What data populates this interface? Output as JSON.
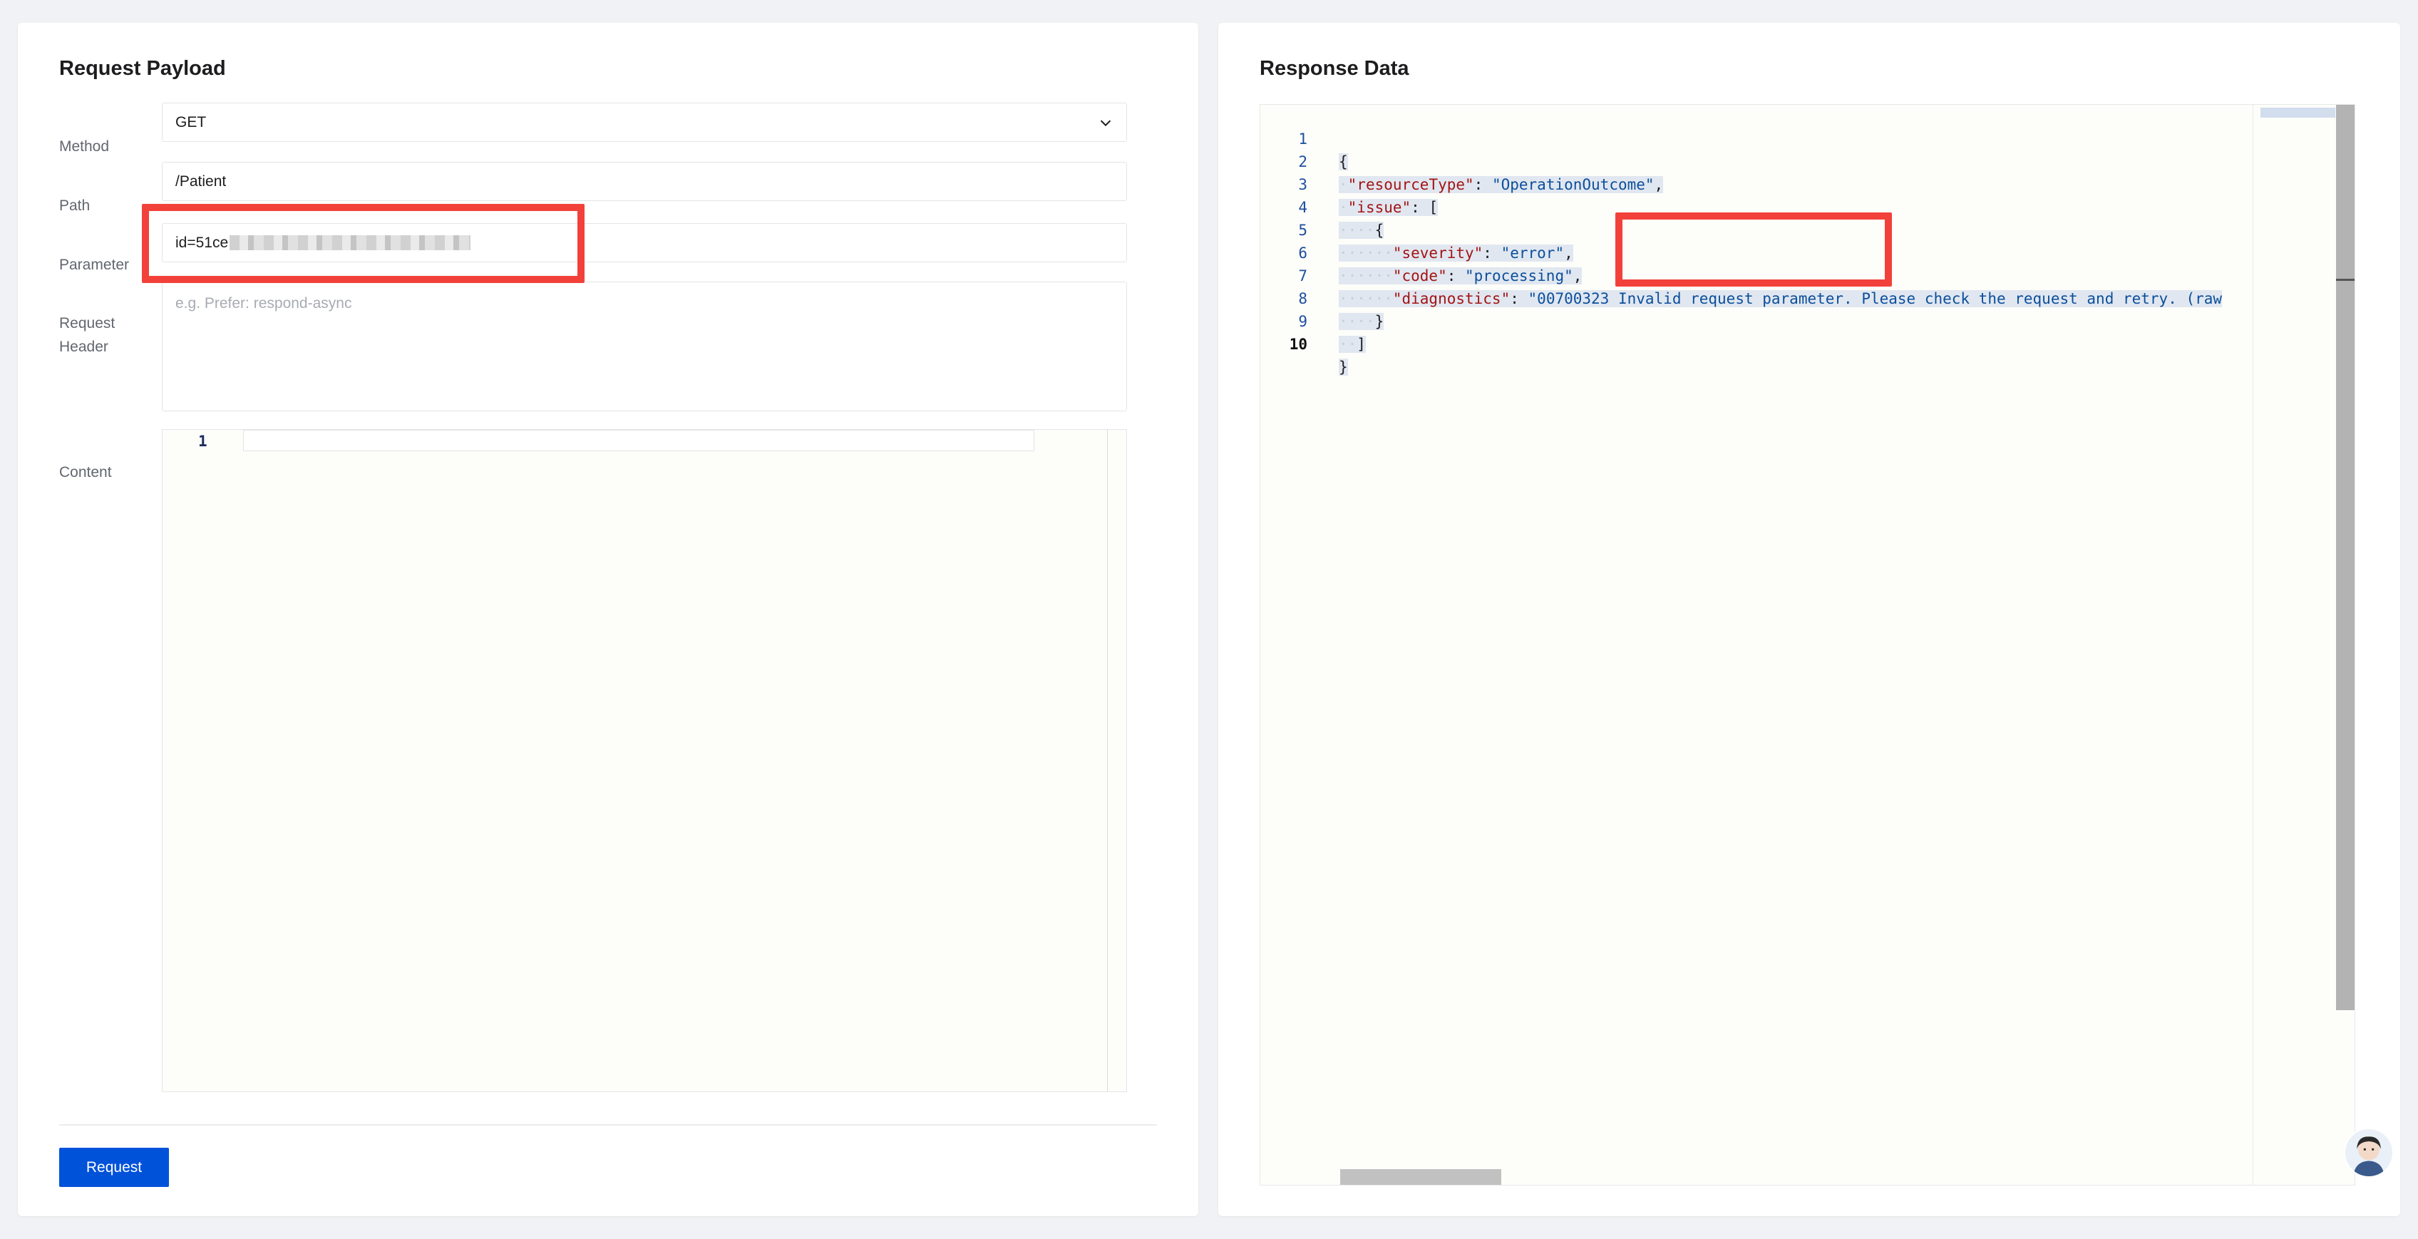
{
  "request": {
    "title": "Request Payload",
    "method_label": "Method",
    "method_value": "GET",
    "path_label": "Path",
    "path_value": "/Patient",
    "parameter_label": "Parameter",
    "parameter_value": "id=51ce",
    "header_label_line1": "Request",
    "header_label_line2": "Header",
    "header_placeholder": "e.g. Prefer: respond-async",
    "content_label": "Content",
    "content_line_number": "1",
    "request_button": "Request"
  },
  "response": {
    "title": "Response Data",
    "line_numbers": [
      "1",
      "2",
      "3",
      "4",
      "5",
      "6",
      "7",
      "8",
      "9",
      "10"
    ],
    "lines": {
      "l1": "{",
      "l2_key": "\"resourceType\"",
      "l2_val": "\"OperationOutcome\"",
      "l3_key": "\"issue\"",
      "l3_rest": ": [",
      "l4": "{",
      "l5_key": "\"severity\"",
      "l5_val": "\"error\"",
      "l6_key": "\"code\"",
      "l6_val": "\"processing\"",
      "l7_key": "\"diagnostics\"",
      "l7_val": "\"00700323 Invalid request parameter. Please check the request and retry. (raw",
      "l8": "}",
      "l9": "]",
      "l10": "}"
    }
  },
  "colors": {
    "primary_button": "#0052d9",
    "highlight_box": "#f2413a",
    "json_key": "#a31515",
    "json_string": "#0b4f9c"
  },
  "icons": {
    "method_dropdown": "chevron-down-icon",
    "assistant": "assistant-avatar-icon"
  }
}
